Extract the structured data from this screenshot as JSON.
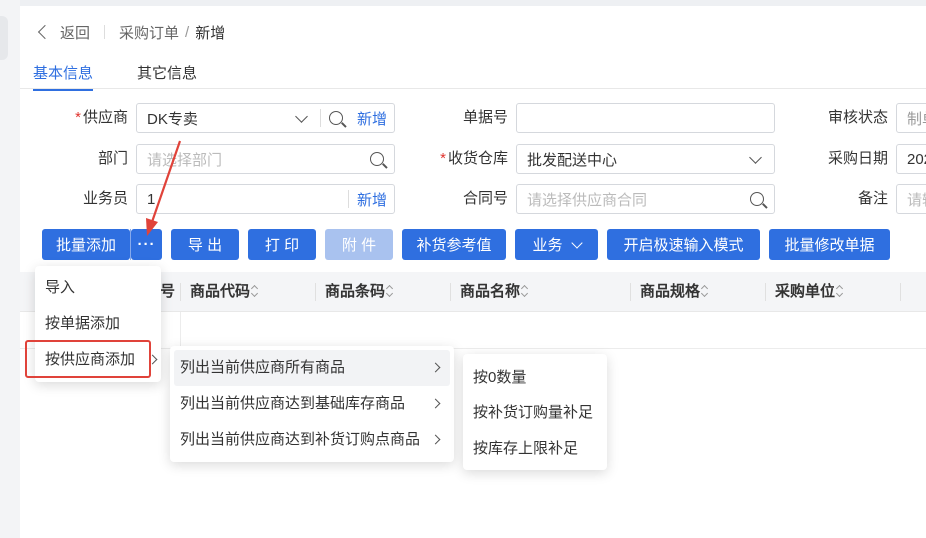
{
  "breadcrumb": {
    "back": "返回",
    "parent": "采购订单",
    "separator": "/",
    "current": "新增"
  },
  "tabs": [
    "基本信息",
    "其它信息"
  ],
  "form": {
    "supplier_label": "供应商",
    "supplier_value": "DK专卖",
    "supplier_new": "新增",
    "dept_label": "部门",
    "dept_placeholder": "请选择部门",
    "staff_label": "业务员",
    "staff_value": "1",
    "staff_new": "新增",
    "doc_no_label": "单据号",
    "doc_no_value": "",
    "warehouse_label": "收货仓库",
    "warehouse_value": "批发配送中心",
    "contract_label": "合同号",
    "contract_placeholder": "请选择供应商合同",
    "audit_label": "审核状态",
    "audit_value": "制单",
    "date_label": "采购日期",
    "date_value": "202",
    "remark_label": "备注",
    "remark_placeholder": "请输"
  },
  "toolbar": {
    "batch_add": "批量添加",
    "more": "···",
    "export": "导 出",
    "print": "打 印",
    "attach": "附 件",
    "replenish_ref": "补货参考值",
    "business": "业务",
    "fast_input": "开启极速输入模式",
    "batch_modify": "批量修改单据"
  },
  "table": {
    "columns": [
      "号",
      "商品代码",
      "商品条码",
      "商品名称",
      "商品规格",
      "采购单位"
    ]
  },
  "menu1": [
    "导入",
    "按单据添加",
    "按供应商添加"
  ],
  "menu2": [
    "列出当前供应商所有商品",
    "列出当前供应商达到基础库存商品",
    "列出当前供应商达到补货订购点商品"
  ],
  "menu3": [
    "按0数量",
    "按补货订购量补足",
    "按库存上限补足"
  ],
  "colors": {
    "primary": "#2f6fe0",
    "disabled": "#a9c2ef",
    "required": "#e0332d",
    "annotation": "#e0433a"
  }
}
